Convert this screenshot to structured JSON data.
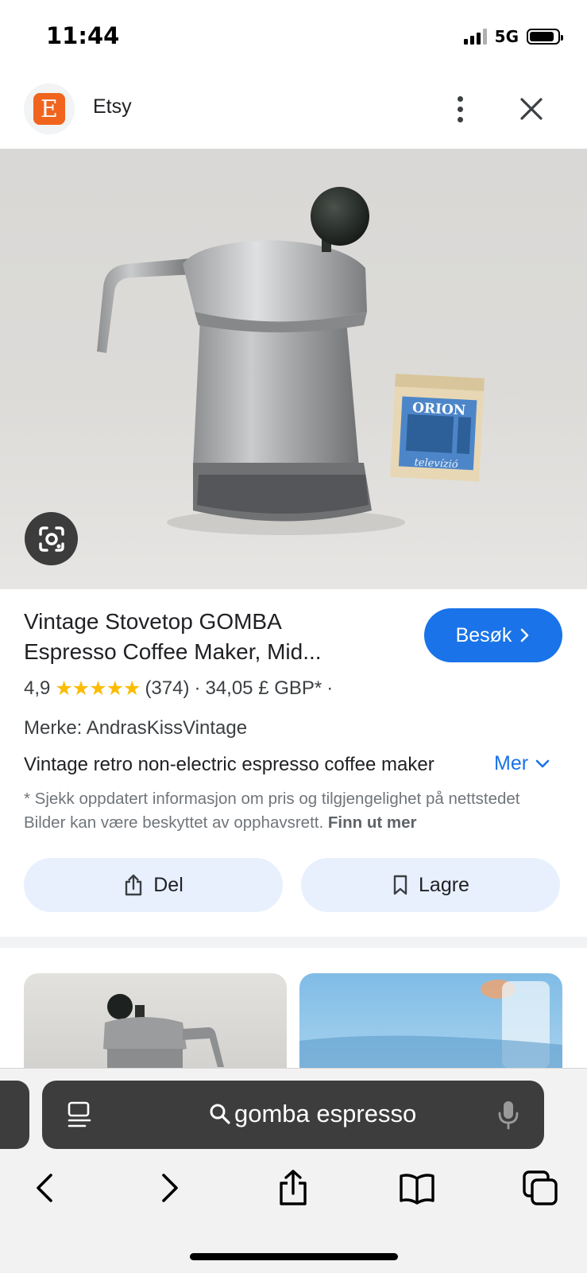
{
  "status": {
    "time": "11:44",
    "network": "5G"
  },
  "header": {
    "site_name": "Etsy",
    "logo_letter": "E"
  },
  "product": {
    "title_line1": "Vintage Stovetop GOMBA",
    "title_line2": "Espresso Coffee Maker, Mid...",
    "visit_label": "Besøk",
    "rating": "4,9",
    "stars": "★★★★★",
    "review_count": "(374)",
    "price": "34,05 £ GBP*",
    "brand": "Merke: AndrasKissVintage",
    "description": "Vintage retro non-electric espresso coffee maker",
    "more_label": "Mer",
    "disclaimer": "* Sjekk oppdatert informasjon om pris og tilgjengelighet på nettstedet Bilder kan være beskyttet av opphavsrett.",
    "learn_more": "Finn ut mer",
    "box_label_top": "ORION",
    "box_label_bottom": "televízió"
  },
  "actions": {
    "share_label": "Del",
    "save_label": "Lagre"
  },
  "browser": {
    "search_query": "gomba espresso"
  },
  "colors": {
    "accent": "#1a73e8",
    "etsy": "#f1641e",
    "star": "#fbbc04"
  }
}
